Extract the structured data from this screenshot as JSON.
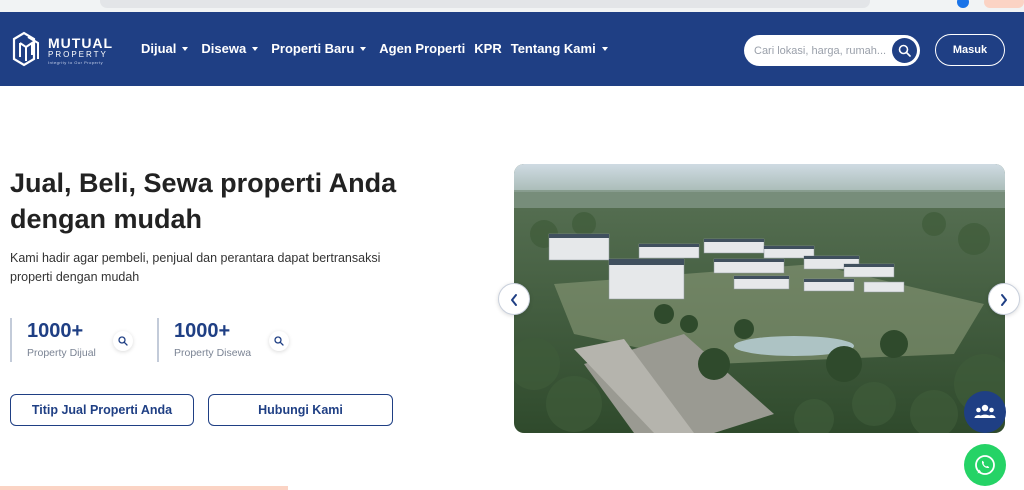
{
  "brand": {
    "name": "MUTUAL",
    "sub": "PROPERTY",
    "tagline": "Integrity to Our Property"
  },
  "nav": {
    "items": [
      {
        "label": "Dijual",
        "dropdown": true
      },
      {
        "label": "Disewa",
        "dropdown": true
      },
      {
        "label": "Properti Baru",
        "dropdown": true
      },
      {
        "label": "Agen Properti",
        "dropdown": false
      },
      {
        "label": "KPR",
        "dropdown": false
      },
      {
        "label": "Tentang Kami",
        "dropdown": true
      }
    ],
    "search_placeholder": "Cari lokasi, harga, rumah...",
    "login_label": "Masuk"
  },
  "hero": {
    "title": "Jual, Beli, Sewa properti Anda dengan mudah",
    "description": "Kami hadir agar pembeli, penjual dan perantara dapat bertransaksi properti dengan mudah",
    "stats": [
      {
        "value": "1000+",
        "label": "Property Dijual"
      },
      {
        "value": "1000+",
        "label": "Property Disewa"
      }
    ],
    "buttons": {
      "primary": "Titip Jual Properti Anda",
      "secondary": "Hubungi Kami"
    }
  },
  "icons": {
    "logo": "mutual-property-logo",
    "search": "search-icon",
    "prev": "chevron-left-icon",
    "next": "chevron-right-icon",
    "community": "users-icon",
    "whatsapp": "whatsapp-icon"
  },
  "colors": {
    "brand_navy": "#1f3f84",
    "whatsapp_green": "#25d366"
  }
}
